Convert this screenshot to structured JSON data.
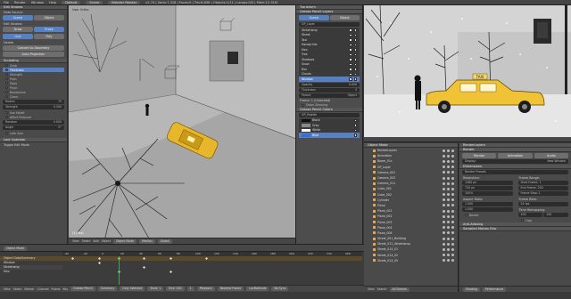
{
  "topbar": {
    "file": "File",
    "render": "Render",
    "window": "Window",
    "help": "Help",
    "layout": "Default",
    "scene": "Scene",
    "engine": "Blender Render",
    "stats": "v2.74 | Verts:7,318 | Faces:0 | Tris:6,838 | Objects:1/11 | Lamps:0/0 | Mem:12.31M"
  },
  "toolshelf": {
    "edit_header": "Edit Strokes",
    "datasource_label": "Data Source:",
    "datasource": [
      "Scene",
      "Object"
    ],
    "strokes_label": "Edit Strokes:",
    "strokes_row1": [
      "Draw",
      "Erase"
    ],
    "strokes_row2": [
      "Line",
      "Poly"
    ],
    "delete_label": "Delete",
    "convert_btn": "Convert to Geometry",
    "convert2_btn": "Auto Projection",
    "modes_header": "Sculpting",
    "modes": [
      "Grab",
      "Thickness",
      "Strength",
      "Push",
      "Twist",
      "Pinch",
      "Randomize",
      "Clone"
    ],
    "radius_label": "Radius",
    "radius_value": "75",
    "strength_label": "Strength",
    "strength_value": "0.300",
    "use_falloff": "Use Falloff",
    "affect_pressure": "Affect Pressure",
    "random_label": "Random",
    "random_value": "0.000",
    "angle_label": "Angle",
    "angle_value": "0°",
    "lock_axis": "Lock Axis",
    "last_header": "Last Operator",
    "last_action": "Toggle Edit Mode"
  },
  "viewport": {
    "label": "User Ortho",
    "object_name": "(1) Taxi",
    "header": {
      "view": "View",
      "select": "Select",
      "add": "Add",
      "object": "Object",
      "mode": "Object Mode",
      "pivot": "Median",
      "snap": "Global"
    }
  },
  "npanel": {
    "transform_header": "Transform",
    "grease_header": "Grease Pencil Layers",
    "gp_tabs": [
      "Scene",
      "Object"
    ],
    "gp_item": "GP_Layer",
    "layers": [
      "Streetlamp",
      "Street",
      "Taxi",
      "Handprints",
      "Man",
      "Tree",
      "Shadows",
      "Snow",
      "Rim",
      "Clouds",
      "Window"
    ],
    "selected_layer": "Window",
    "opacity_label": "Opacity",
    "opacity_value": "0.000",
    "thickness_label": "Thickness",
    "thickness_value": "3",
    "parent_label": "Parent",
    "parent_value": "Object",
    "frame_label": "Frame: 1 (Unlocked)",
    "onion_label": "Onion Skinning",
    "colors_header": "Grease Pencil Colors",
    "colors_label": "GP_Palette",
    "color_items": [
      "Black",
      "Grey",
      "White",
      "Blue"
    ],
    "selected_color": "Blue"
  },
  "render_view": {
    "taxi_sign": "TAXI"
  },
  "outliner": {
    "header": "Object Mode",
    "items": [
      "RenderLayers",
      "Animation",
      "Beam_01c",
      "GP_Layer",
      "Camera_001",
      "Camera_003",
      "Camera_011",
      "Cube_001",
      "Cube_002",
      "Cylinder",
      "Plane",
      "Plane_001",
      "Plane_002",
      "Plane_003",
      "Plane_004",
      "Plane_006",
      "Street_001_Building",
      "Street_012_Streetlamp",
      "Street_014_01",
      "Street_014_02",
      "Street_014_05"
    ],
    "footer_view": "View",
    "footer_search": "Search",
    "footer_scene": "All Scenes"
  },
  "properties": {
    "header_layer": "RenderLayers",
    "render_header": "Render",
    "render_buttons": [
      "Render",
      "Animation",
      "Audio"
    ],
    "display_label": "Display:",
    "display_value": "New Window",
    "dimensions_header": "Dimensions",
    "preset_label": "Render Presets",
    "resolution_label": "Resolution:",
    "res_x": "1280 px",
    "res_y": "720 px",
    "res_pct": "100%",
    "frame_range_label": "Frame Range:",
    "start_frame": "Start Frame: 1",
    "end_frame": "End Frame: 250",
    "frame_step": "Frame Step: 1",
    "aspect_label": "Aspect Ratio:",
    "aspect_x": "1.000",
    "aspect_y": "1.000",
    "frame_rate_label": "Frame Rate:",
    "frame_rate_value": "24 fps",
    "time_remap_label": "Time Remapping:",
    "remap_old": "100",
    "remap_new": "100",
    "border_label": "Border",
    "crop_label": "Crop",
    "aa_header": "Anti-Aliasing",
    "sampled_label": "Sampled Motion Blur",
    "footer_render": "Shading",
    "footer_item": "Performance"
  },
  "timeline": {
    "header": "Object Mode",
    "rows": [
      "Object Data/Summary",
      "Window",
      "Streetlamp",
      "Man"
    ],
    "active_row": "Object Data/Summary",
    "ticks": [
      "-40",
      "-20",
      "0",
      "20",
      "40",
      "60",
      "80",
      "100",
      "120",
      "140",
      "160",
      "180",
      "200",
      "220",
      "240",
      "260"
    ],
    "footer": {
      "view": "View",
      "select": "Select",
      "marker": "Marker",
      "channel": "Channel",
      "frame": "Frame",
      "key": "Key",
      "mode": "Grease Pencil",
      "summary": "Summary",
      "only_sel": "Only Selected",
      "start": "Start: 1",
      "end": "End: 250",
      "current": "1",
      "playback": "Playback",
      "nearest": "Nearest Frame",
      "keying": "LocRotScale",
      "sync": "No Sync"
    }
  }
}
